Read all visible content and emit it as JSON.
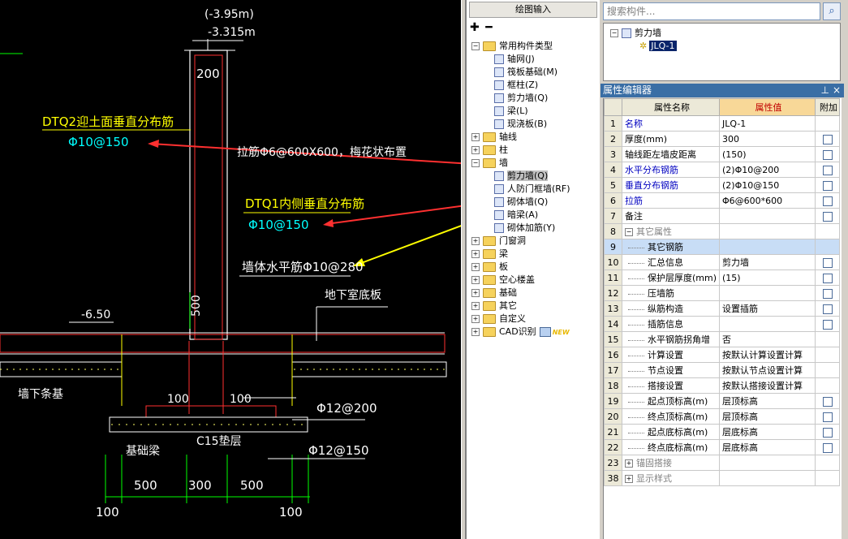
{
  "cad": {
    "elev_top": "(-3.95m)",
    "elev_sub": "-3.315m",
    "dim_200": "200",
    "annot_dtq2": "DTQ2迎土面垂直分布筋",
    "rebar_dtq2": "Φ10@150",
    "annot_lajin": "拉筋Φ6@600X600，梅花状布置",
    "annot_dtq1": "DTQ1内侧垂直分布筋",
    "rebar_dtq1": "Φ10@150",
    "annot_horiz": "墙体水平筋Φ10@280",
    "annot_slab": "地下室底板",
    "elev_650": "-6.50",
    "dim_500v": "500",
    "annot_strip": "墙下条基",
    "dim_100a": "100",
    "dim_100b": "100",
    "rebar_12_200": "Φ12@200",
    "annot_beam": "基础梁",
    "annot_c15": "C15垫层",
    "rebar_12_150": "Φ12@150",
    "dim_500a": "500",
    "dim_300": "300",
    "dim_500b": "500",
    "dim_100c": "100",
    "dim_100d": "100"
  },
  "mid": {
    "draw_input": "绘图输入",
    "tree": [
      {
        "label": "常用构件类型",
        "kind": "folder",
        "expander": "−"
      },
      {
        "label": "轴网(J)",
        "kind": "comp"
      },
      {
        "label": "筏板基础(M)",
        "kind": "comp"
      },
      {
        "label": "框柱(Z)",
        "kind": "comp"
      },
      {
        "label": "剪力墙(Q)",
        "kind": "comp"
      },
      {
        "label": "梁(L)",
        "kind": "comp"
      },
      {
        "label": "现浇板(B)",
        "kind": "comp"
      },
      {
        "label": "轴线",
        "kind": "folder",
        "expander": "+"
      },
      {
        "label": "柱",
        "kind": "folder",
        "expander": "+"
      },
      {
        "label": "墙",
        "kind": "folder",
        "expander": "−"
      },
      {
        "label": "剪力墙(Q)",
        "kind": "comp",
        "selected": true
      },
      {
        "label": "人防门框墙(RF)",
        "kind": "comp"
      },
      {
        "label": "砌体墙(Q)",
        "kind": "comp"
      },
      {
        "label": "暗梁(A)",
        "kind": "comp"
      },
      {
        "label": "砌体加筋(Y)",
        "kind": "comp"
      },
      {
        "label": "门窗洞",
        "kind": "folder",
        "expander": "+"
      },
      {
        "label": "梁",
        "kind": "folder",
        "expander": "+"
      },
      {
        "label": "板",
        "kind": "folder",
        "expander": "+"
      },
      {
        "label": "空心楼盖",
        "kind": "folder",
        "expander": "+"
      },
      {
        "label": "基础",
        "kind": "folder",
        "expander": "+"
      },
      {
        "label": "其它",
        "kind": "folder",
        "expander": "+"
      },
      {
        "label": "自定义",
        "kind": "folder",
        "expander": "+"
      },
      {
        "label": "CAD识别",
        "kind": "folder",
        "expander": "+",
        "badge": "NEW"
      }
    ]
  },
  "right": {
    "search_placeholder": "搜索构件...",
    "comp_tree_root": "剪力墙",
    "comp_tree_child": "JLQ-1",
    "prop_title": "属性编辑器",
    "col_name": "属性名称",
    "col_value": "属性值",
    "col_add": "附加",
    "rows": [
      {
        "num": "1",
        "name": "名称",
        "value": "JLQ-1",
        "style": "blue",
        "cb": false
      },
      {
        "num": "2",
        "name": "厚度(mm)",
        "value": "300",
        "style": "",
        "cb": true
      },
      {
        "num": "3",
        "name": "轴线距左墙皮距离",
        "value": "(150)",
        "style": "",
        "cb": true
      },
      {
        "num": "4",
        "name": "水平分布钢筋",
        "value": "(2)Φ10@200",
        "style": "blue",
        "cb": true
      },
      {
        "num": "5",
        "name": "垂直分布钢筋",
        "value": "(2)Φ10@150",
        "style": "blue",
        "cb": true
      },
      {
        "num": "6",
        "name": "拉筋",
        "value": "Φ6@600*600",
        "style": "blue",
        "cb": true
      },
      {
        "num": "7",
        "name": "备注",
        "value": "",
        "style": "",
        "cb": true
      },
      {
        "num": "8",
        "name": "其它属性",
        "value": "",
        "style": "group",
        "cb": false
      },
      {
        "num": "9",
        "name": "其它钢筋",
        "value": "",
        "style": "sel",
        "cb": false
      },
      {
        "num": "10",
        "name": "汇总信息",
        "value": "剪力墙",
        "style": "sub",
        "cb": true
      },
      {
        "num": "11",
        "name": "保护层厚度(mm)",
        "value": "(15)",
        "style": "sub",
        "cb": true
      },
      {
        "num": "12",
        "name": "压墙筋",
        "value": "",
        "style": "sub",
        "cb": true
      },
      {
        "num": "13",
        "name": "纵筋构造",
        "value": "设置插筋",
        "style": "sub",
        "cb": true
      },
      {
        "num": "14",
        "name": "插筋信息",
        "value": "",
        "style": "sub",
        "cb": true
      },
      {
        "num": "15",
        "name": "水平钢筋拐角增",
        "value": "否",
        "style": "sub",
        "cb": false
      },
      {
        "num": "16",
        "name": "计算设置",
        "value": "按默认计算设置计算",
        "style": "sub",
        "cb": false
      },
      {
        "num": "17",
        "name": "节点设置",
        "value": "按默认节点设置计算",
        "style": "sub",
        "cb": false
      },
      {
        "num": "18",
        "name": "搭接设置",
        "value": "按默认搭接设置计算",
        "style": "sub",
        "cb": false
      },
      {
        "num": "19",
        "name": "起点顶标高(m)",
        "value": "层顶标高",
        "style": "sub",
        "cb": true
      },
      {
        "num": "20",
        "name": "终点顶标高(m)",
        "value": "层顶标高",
        "style": "sub",
        "cb": true
      },
      {
        "num": "21",
        "name": "起点底标高(m)",
        "value": "层底标高",
        "style": "sub",
        "cb": true
      },
      {
        "num": "22",
        "name": "终点底标高(m)",
        "value": "层底标高",
        "style": "sub",
        "cb": true
      },
      {
        "num": "23",
        "name": "锚固搭接",
        "value": "",
        "style": "groupc",
        "cb": false
      },
      {
        "num": "38",
        "name": "显示样式",
        "value": "",
        "style": "groupc",
        "cb": false
      }
    ]
  }
}
